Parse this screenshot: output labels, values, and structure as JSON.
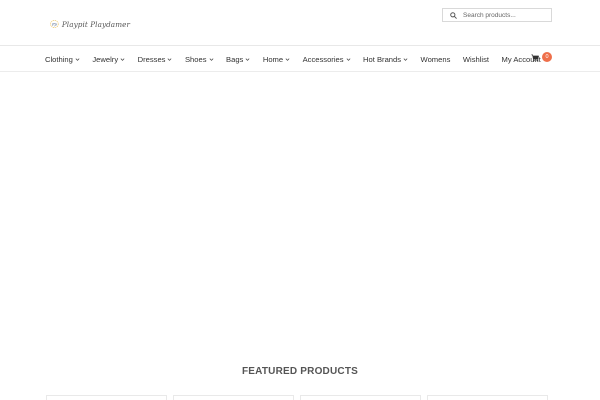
{
  "brand": {
    "name": "Playpit Playdamer",
    "logo_icon": "monogram-logo-icon",
    "logo_colors": [
      "#2d4a78",
      "#e6b43a"
    ]
  },
  "search": {
    "placeholder": "Search products...",
    "icon": "search-icon"
  },
  "nav": {
    "items": [
      {
        "label": "Clothing",
        "has_dropdown": true
      },
      {
        "label": "Jewelry",
        "has_dropdown": true
      },
      {
        "label": "Dresses",
        "has_dropdown": true
      },
      {
        "label": "Shoes",
        "has_dropdown": true
      },
      {
        "label": "Bags",
        "has_dropdown": true
      },
      {
        "label": "Home",
        "has_dropdown": true
      },
      {
        "label": "Accessories",
        "has_dropdown": true
      },
      {
        "label": "Hot Brands",
        "has_dropdown": true
      },
      {
        "label": "Womens",
        "has_dropdown": false
      },
      {
        "label": "Wishlist",
        "has_dropdown": false
      },
      {
        "label": "My Account",
        "has_dropdown": false
      }
    ]
  },
  "cart": {
    "icon": "cart-icon",
    "count": "0",
    "badge_color": "#ee6f4a"
  },
  "featured": {
    "title": "FEATURED PRODUCTS"
  },
  "product_cards": [
    "",
    "",
    "",
    ""
  ]
}
